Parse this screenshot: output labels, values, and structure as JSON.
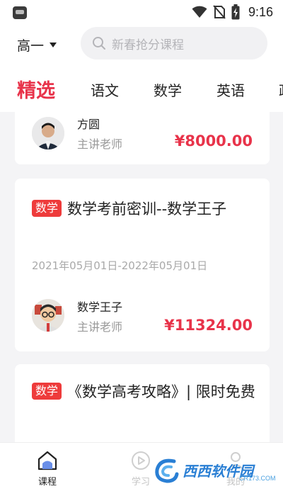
{
  "status_bar": {
    "time": "9:16",
    "icons": [
      "app-icon",
      "wifi-icon",
      "no-sim-icon",
      "battery-charging-icon"
    ]
  },
  "header": {
    "grade": "高一",
    "search_placeholder": "新春抢分课程"
  },
  "tabs": [
    {
      "label": "精选",
      "active": true
    },
    {
      "label": "语文",
      "active": false
    },
    {
      "label": "数学",
      "active": false
    },
    {
      "label": "英语",
      "active": false
    },
    {
      "label": "政",
      "active": false
    }
  ],
  "cards": [
    {
      "teacher_name": "方圆",
      "teacher_role": "主讲老师",
      "price": "¥8000.00"
    },
    {
      "badge": "数学",
      "title": "数学考前密训--数学王子",
      "date_range": "2021年05月01日-2022年05月01日",
      "teacher_name": "数学王子",
      "teacher_role": "主讲老师",
      "price": "¥11324.00"
    },
    {
      "badge": "数学",
      "title": "《数学高考攻略》| 限时免费"
    }
  ],
  "bottom_nav": [
    {
      "label": "课程",
      "icon": "home-icon",
      "active": true
    },
    {
      "label": "学习",
      "icon": "play-icon",
      "active": false
    },
    {
      "label": "我的",
      "icon": "user-icon",
      "active": false
    }
  ],
  "watermark": {
    "main": "西西软件园",
    "sub": "CR173.COM"
  },
  "colors": {
    "accent": "#e8334a",
    "badge": "#ee3b3b",
    "background": "#f4f4f6"
  }
}
